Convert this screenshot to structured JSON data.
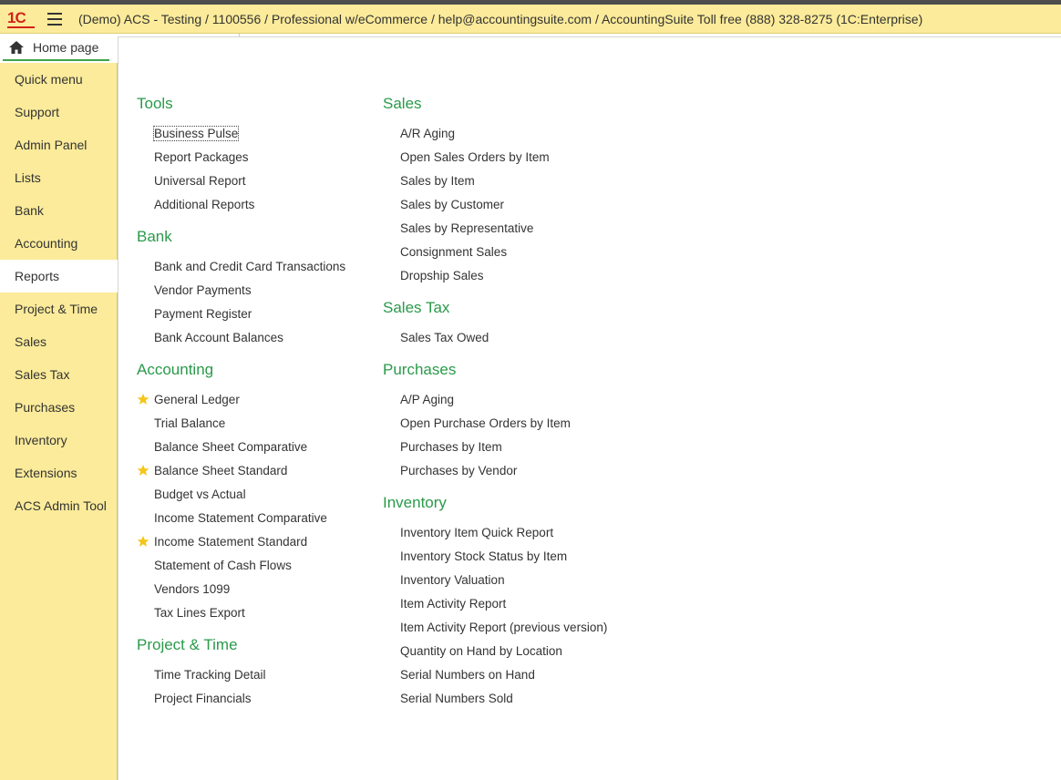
{
  "titlebar": {
    "logo_text": "1С",
    "app_title": "(Demo) ACS - Testing / 1100556 / Professional w/eCommerce / help@accountingsuite.com / AccountingSuite Toll free (888) 328-8275  (1C:Enterprise)"
  },
  "tabs": {
    "home_label": "Home page"
  },
  "sidebar": {
    "items": [
      {
        "label": "Quick menu"
      },
      {
        "label": "Support"
      },
      {
        "label": "Admin Panel"
      },
      {
        "label": "Lists"
      },
      {
        "label": "Bank"
      },
      {
        "label": "Accounting"
      },
      {
        "label": "Reports",
        "active": true
      },
      {
        "label": "Project & Time"
      },
      {
        "label": "Sales"
      },
      {
        "label": "Sales Tax"
      },
      {
        "label": "Purchases"
      },
      {
        "label": "Inventory"
      },
      {
        "label": "Extensions"
      },
      {
        "label": "ACS Admin Tool"
      }
    ]
  },
  "colors": {
    "section_title": "#2a9a4a",
    "sidebar_bg": "#fbeb9a",
    "star": "#f5c518"
  },
  "columns": [
    {
      "sections": [
        {
          "title": "Tools",
          "items": [
            {
              "label": "Business Pulse",
              "focused": true
            },
            {
              "label": "Report Packages"
            },
            {
              "label": "Universal Report"
            },
            {
              "label": "Additional Reports"
            }
          ]
        },
        {
          "title": "Bank",
          "items": [
            {
              "label": "Bank and Credit Card Transactions"
            },
            {
              "label": "Vendor Payments"
            },
            {
              "label": "Payment Register"
            },
            {
              "label": "Bank Account Balances"
            }
          ]
        },
        {
          "title": "Accounting",
          "items": [
            {
              "label": "General Ledger",
              "starred": true
            },
            {
              "label": "Trial Balance"
            },
            {
              "label": "Balance Sheet Comparative"
            },
            {
              "label": "Balance Sheet Standard",
              "starred": true
            },
            {
              "label": "Budget vs Actual"
            },
            {
              "label": "Income Statement Comparative"
            },
            {
              "label": "Income Statement Standard",
              "starred": true
            },
            {
              "label": "Statement of Cash Flows"
            },
            {
              "label": "Vendors 1099"
            },
            {
              "label": "Tax Lines Export"
            }
          ]
        },
        {
          "title": "Project & Time",
          "items": [
            {
              "label": "Time Tracking Detail"
            },
            {
              "label": "Project Financials"
            }
          ]
        }
      ]
    },
    {
      "sections": [
        {
          "title": "Sales",
          "items": [
            {
              "label": "A/R Aging"
            },
            {
              "label": "Open Sales Orders by Item"
            },
            {
              "label": "Sales by Item"
            },
            {
              "label": "Sales by Customer"
            },
            {
              "label": "Sales by Representative"
            },
            {
              "label": "Consignment Sales"
            },
            {
              "label": "Dropship Sales"
            }
          ]
        },
        {
          "title": "Sales Tax",
          "items": [
            {
              "label": "Sales Tax Owed"
            }
          ]
        },
        {
          "title": "Purchases",
          "items": [
            {
              "label": "A/P Aging"
            },
            {
              "label": "Open Purchase Orders by Item"
            },
            {
              "label": "Purchases by Item"
            },
            {
              "label": "Purchases by Vendor"
            }
          ]
        },
        {
          "title": "Inventory",
          "items": [
            {
              "label": "Inventory Item Quick Report"
            },
            {
              "label": "Inventory Stock Status by Item"
            },
            {
              "label": "Inventory Valuation"
            },
            {
              "label": "Item Activity Report"
            },
            {
              "label": "Item Activity Report (previous version)"
            },
            {
              "label": "Quantity on Hand by Location"
            },
            {
              "label": "Serial Numbers on Hand"
            },
            {
              "label": "Serial Numbers Sold"
            }
          ]
        }
      ]
    }
  ]
}
